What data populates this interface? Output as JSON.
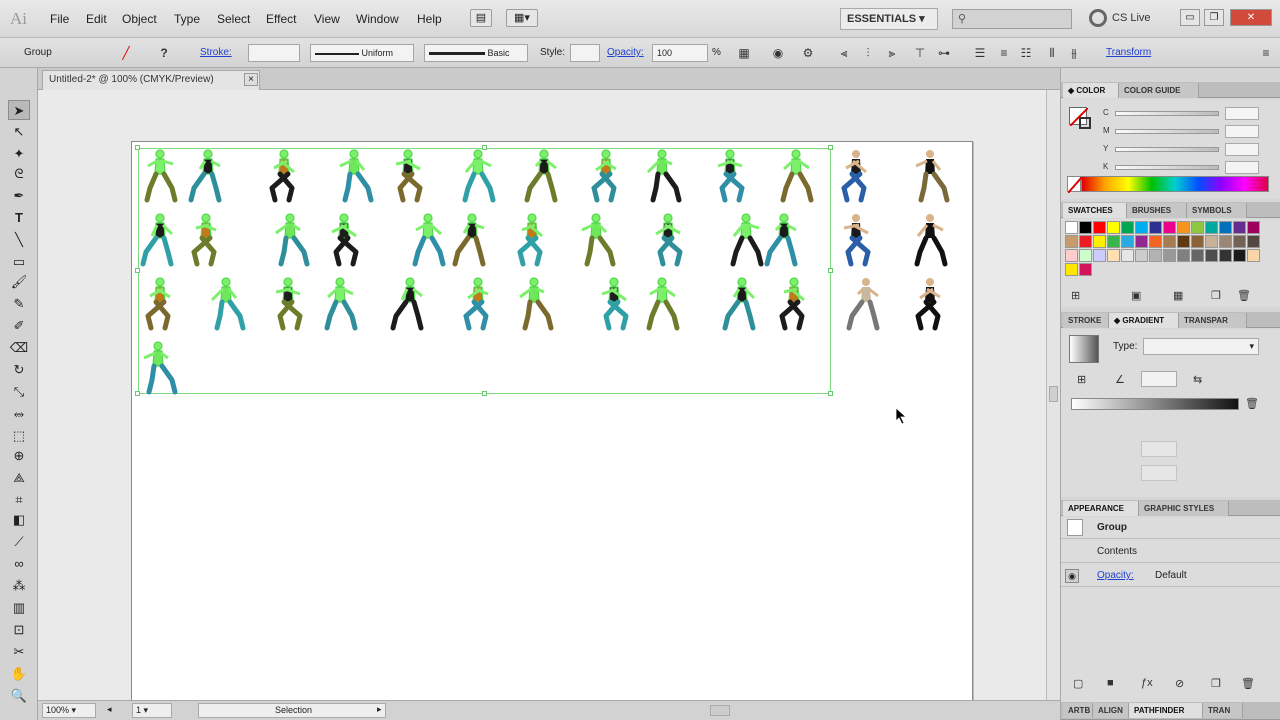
{
  "app": {
    "logo": "Ai"
  },
  "menu": [
    "File",
    "Edit",
    "Object",
    "Type",
    "Select",
    "Effect",
    "View",
    "Window",
    "Help"
  ],
  "workspace": "ESSENTIALS",
  "search_placeholder": "",
  "cs_live": "CS Live",
  "control": {
    "selection_type": "Group",
    "stroke_label": "Stroke:",
    "stroke_profile": "Uniform",
    "brush": "Basic",
    "style_label": "Style:",
    "opacity_label": "Opacity:",
    "opacity_value": "100",
    "opacity_unit": "%",
    "transform_label": "Transform"
  },
  "document": {
    "tab": "Untitled-2* @ 100% (CMYK/Preview)",
    "close": "×"
  },
  "status": {
    "zoom": "100%",
    "artboard": "1",
    "mode": "Selection"
  },
  "panels": {
    "color_tabs": [
      "◆ COLOR",
      "COLOR GUIDE"
    ],
    "cmyk_labels": [
      "C",
      "M",
      "Y",
      "K"
    ],
    "swatch_tabs": [
      "SWATCHES",
      "BRUSHES",
      "SYMBOLS"
    ],
    "stroke_tabs": [
      "STROKE",
      "◆ GRADIENT",
      "TRANSPAR"
    ],
    "gradient_type_label": "Type:",
    "appearance_tabs": [
      "APPEARANCE",
      "GRAPHIC STYLES"
    ],
    "appearance": {
      "group": "Group",
      "contents": "Contents",
      "opacity_label": "Opacity:",
      "opacity_value": "Default"
    },
    "bottom_tabs": [
      "ARTB",
      "ALIGN",
      "PATHFINDER",
      "TRAN"
    ]
  },
  "swatch_colors": [
    "#ffffff",
    "#000000",
    "#ff0000",
    "#ffff00",
    "#00a651",
    "#00aeef",
    "#2e3192",
    "#ec008c",
    "#f7941d",
    "#8dc63f",
    "#00a99d",
    "#0072bc",
    "#662d91",
    "#9e005d",
    "#c69c6d",
    "#ed1c24",
    "#fff200",
    "#39b54a",
    "#29abe2",
    "#92278f",
    "#f26522",
    "#a67c52",
    "#603913",
    "#8c6239",
    "#c7b299",
    "#998675",
    "#736357",
    "#534741",
    "#ffcccc",
    "#ccffcc",
    "#ccccff",
    "#ffe0b3",
    "#e6e6e6",
    "#cccccc",
    "#b3b3b3",
    "#999999",
    "#808080",
    "#666666",
    "#4d4d4d",
    "#333333",
    "#1a1a1a",
    "#f9d6a6",
    "#ffe600",
    "#d4145a"
  ]
}
